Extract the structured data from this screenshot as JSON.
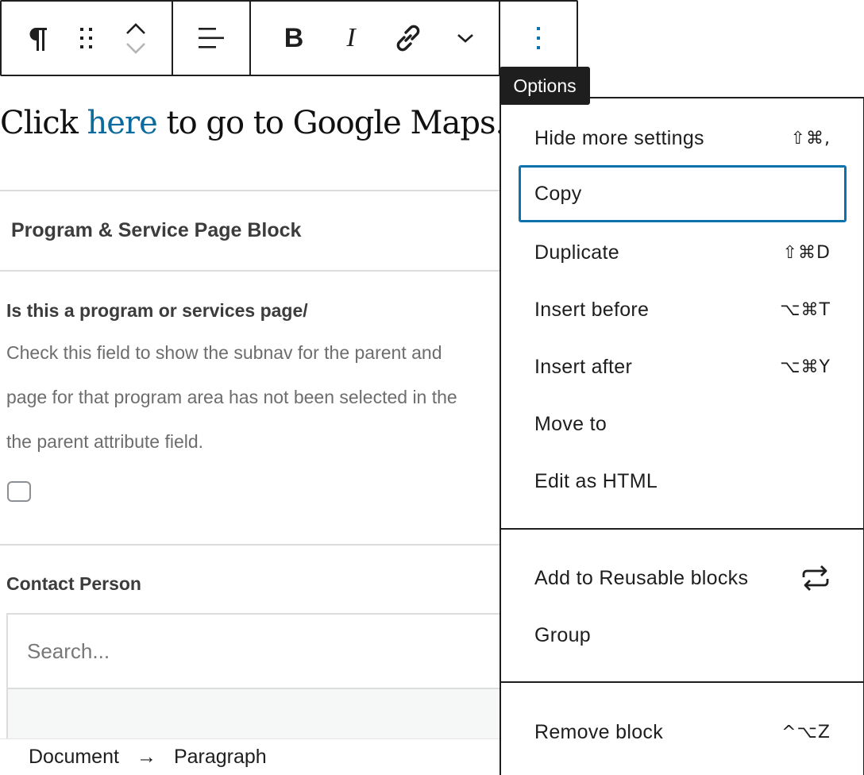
{
  "toolbar": {
    "paragraph_icon": "paragraph-icon",
    "drag_icon": "drag-handle-icon",
    "move_up_icon": "chevron-up-icon",
    "move_down_icon": "chevron-down-icon",
    "align_icon": "align-left-icon",
    "bold_label": "B",
    "italic_label": "I",
    "link_icon": "link-icon",
    "more_formats_icon": "chevron-down-icon",
    "options_icon": "vertical-ellipsis-icon"
  },
  "tooltip": {
    "text": "Options"
  },
  "paragraph": {
    "before": "Click ",
    "link": "here",
    "after": " to go to Google Maps."
  },
  "block": {
    "title": "Program & Service Page Block",
    "field1_label": "Is this a program or services page/",
    "field1_desc": [
      "Check this field to show the subnav for the parent and",
      "page for that program area has not been selected in the",
      "the parent attribute field."
    ],
    "field2_label": "Contact Person",
    "search_placeholder": "Search..."
  },
  "menu": {
    "items": [
      {
        "label": "Hide more settings",
        "shortcut": "⇧⌘,"
      },
      {
        "label": "Copy",
        "shortcut": ""
      },
      {
        "label": "Duplicate",
        "shortcut": "⇧⌘D"
      },
      {
        "label": "Insert before",
        "shortcut": "⌥⌘T"
      },
      {
        "label": "Insert after",
        "shortcut": "⌥⌘Y"
      },
      {
        "label": "Move to",
        "shortcut": ""
      },
      {
        "label": "Edit as HTML",
        "shortcut": ""
      }
    ],
    "reusable": {
      "label": "Add to Reusable blocks",
      "icon": "reusable-block-icon"
    },
    "group": {
      "label": "Group"
    },
    "remove": {
      "label": "Remove block",
      "shortcut": "^⌥Z"
    }
  },
  "breadcrumb": {
    "items": [
      "Document",
      "Paragraph"
    ],
    "separator": "→"
  },
  "colors": {
    "accent": "#0c72ac",
    "link": "#0c6b9e",
    "dark": "#1e1e1e",
    "options_icon": "#0c72ac"
  }
}
